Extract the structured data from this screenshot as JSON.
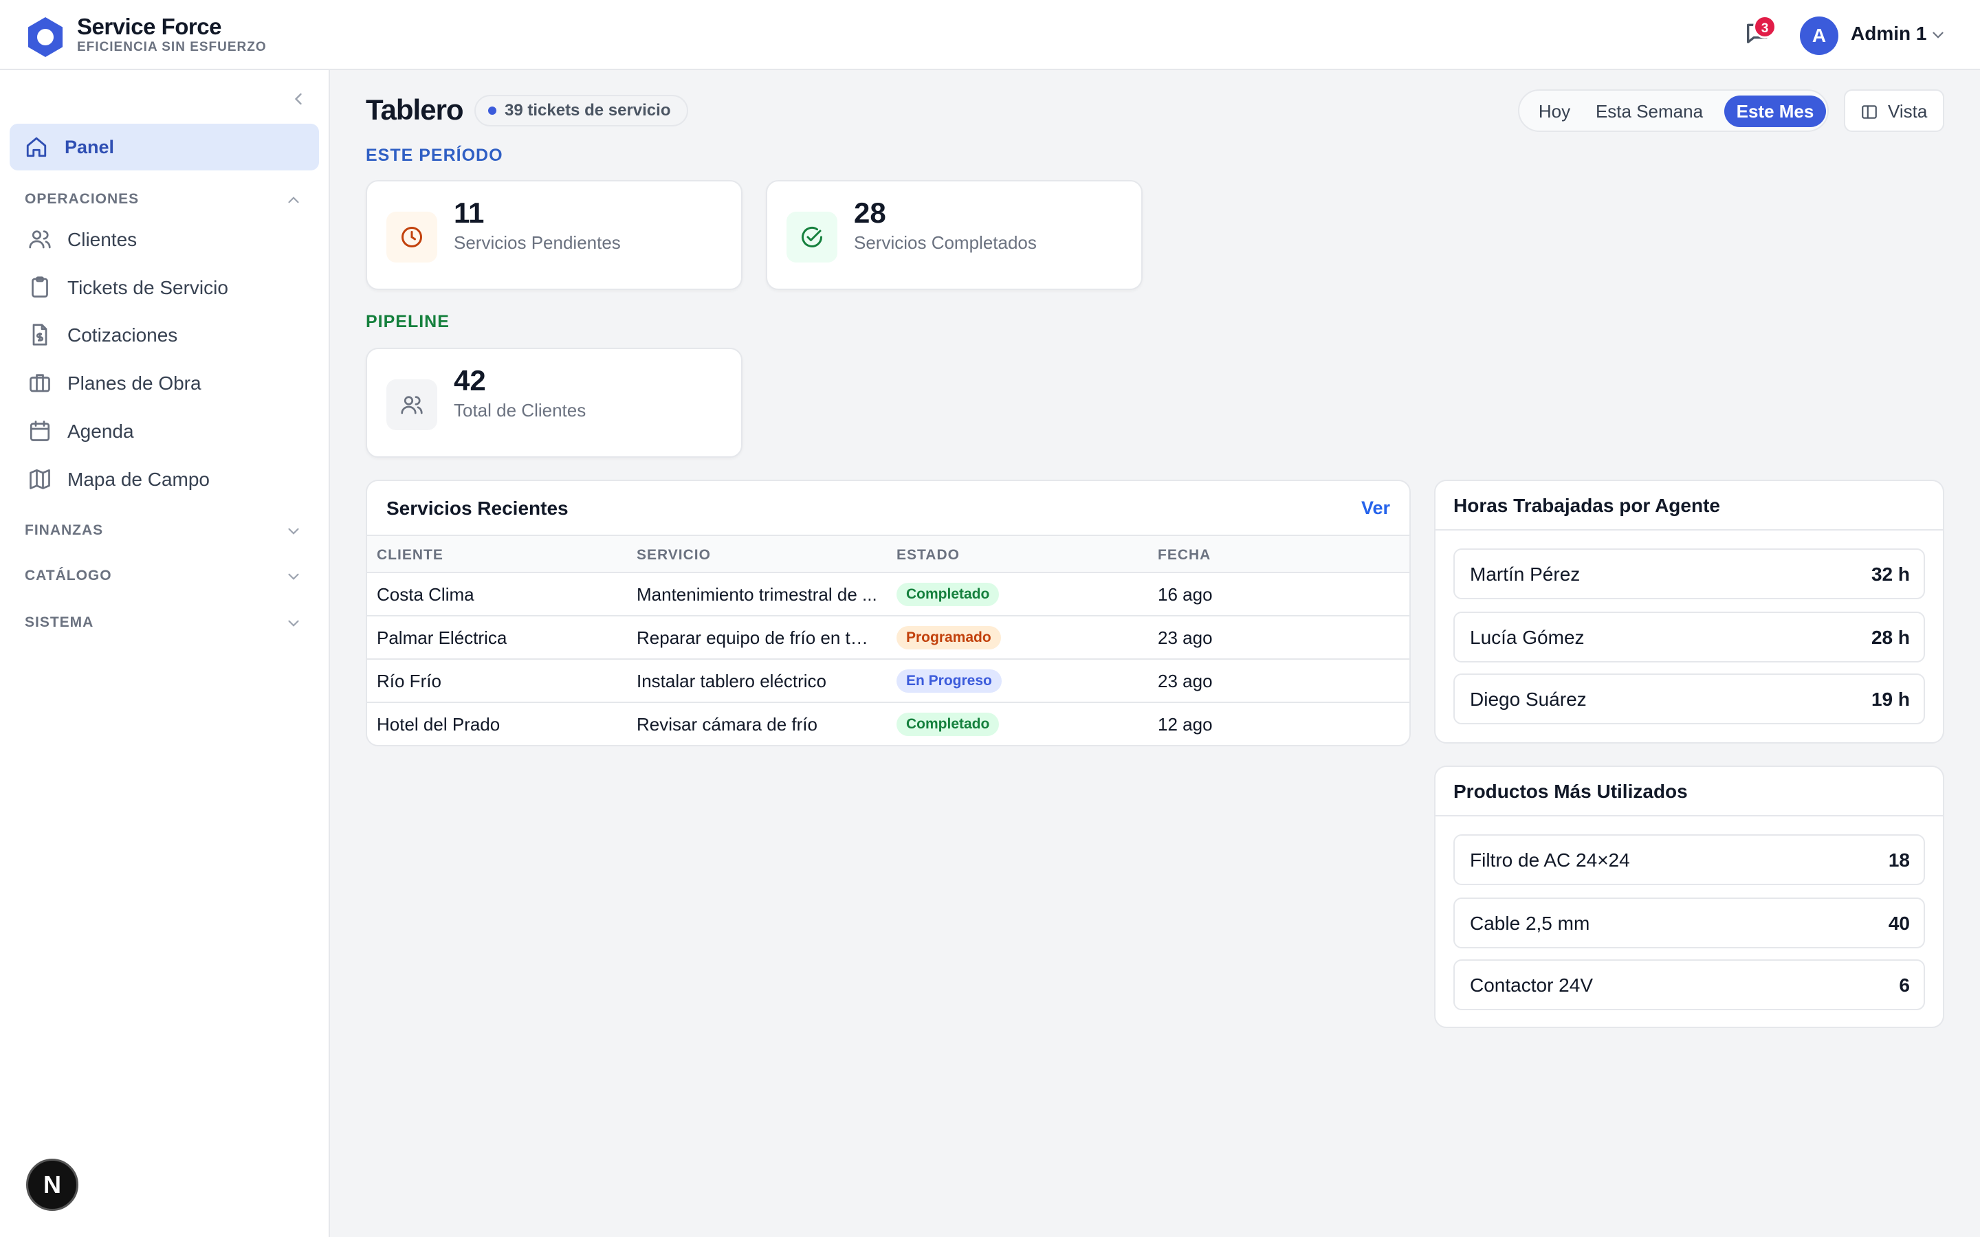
{
  "brand": {
    "name": "Service Force",
    "tagline": "EFICIENCIA SIN ESFUERZO"
  },
  "header": {
    "notifications_count": "3",
    "user_initial": "A",
    "user_name": "Admin 1"
  },
  "sidebar": {
    "active": {
      "label": "Panel"
    },
    "sections": [
      {
        "label": "OPERACIONES",
        "expanded": true
      },
      {
        "label": "FINANZAS",
        "expanded": false
      },
      {
        "label": "CATÁLOGO",
        "expanded": false
      },
      {
        "label": "SISTEMA",
        "expanded": false
      }
    ],
    "items": [
      {
        "label": "Clientes",
        "icon": "users-icon"
      },
      {
        "label": "Tickets de Servicio",
        "icon": "clipboard-icon"
      },
      {
        "label": "Cotizaciones",
        "icon": "invoice-icon"
      },
      {
        "label": "Planes de Obra",
        "icon": "briefcase-icon"
      },
      {
        "label": "Agenda",
        "icon": "calendar-icon"
      },
      {
        "label": "Mapa de Campo",
        "icon": "map-icon"
      }
    ],
    "bottom_badge": "N"
  },
  "main": {
    "title": "Tablero",
    "tickets_pill": "39 tickets de servicio",
    "ranges": [
      "Hoy",
      "Esta Semana",
      "Este Mes"
    ],
    "active_range": "Este Mes",
    "view_button": "Vista",
    "period_label": "ESTE PERÍODO",
    "pipeline_label": "PIPELINE",
    "stats": [
      {
        "value": "11",
        "label": "Servicios Pendientes",
        "icon": "clock-icon",
        "color": "#c2410c"
      },
      {
        "value": "28",
        "label": "Servicios Completados",
        "icon": "check-circle-icon",
        "color": "#15803d"
      },
      {
        "value": "42",
        "label": "Total de Clientes",
        "icon": "users-icon",
        "color": "#6b7280"
      }
    ]
  },
  "recent": {
    "title": "Servicios Recientes",
    "link": "Ver",
    "columns": [
      "CLIENTE",
      "SERVICIO",
      "ESTADO",
      "FECHA"
    ],
    "rows": [
      {
        "cliente": "Costa Clima",
        "servicio": "Mantenimiento trimestral de ...",
        "estado": "Completado",
        "fecha": "16 ago"
      },
      {
        "cliente": "Palmar Eléctrica",
        "servicio": "Reparar equipo de frío en ter...",
        "estado": "Programado",
        "fecha": "23 ago"
      },
      {
        "cliente": "Río Frío",
        "servicio": "Instalar tablero eléctrico",
        "estado": "En Progreso",
        "fecha": "23 ago"
      },
      {
        "cliente": "Hotel del Prado",
        "servicio": "Revisar cámara de frío",
        "estado": "Completado",
        "fecha": "12 ago"
      }
    ]
  },
  "hours": {
    "title": "Horas Trabajadas por Agente",
    "rows": [
      {
        "name": "Martín Pérez",
        "value": "32 h"
      },
      {
        "name": "Lucía Gómez",
        "value": "28 h"
      },
      {
        "name": "Diego Suárez",
        "value": "19 h"
      }
    ]
  },
  "products": {
    "title": "Productos Más Utilizados",
    "rows": [
      {
        "name": "Filtro de AC 24×24",
        "value": "18"
      },
      {
        "name": "Cable 2,5 mm",
        "value": "40"
      },
      {
        "name": "Contactor 24V",
        "value": "6"
      }
    ]
  },
  "colors": {
    "accent": "#3b5bdb",
    "period_label": "#2f5fc4",
    "pipeline_label": "#15803d"
  }
}
